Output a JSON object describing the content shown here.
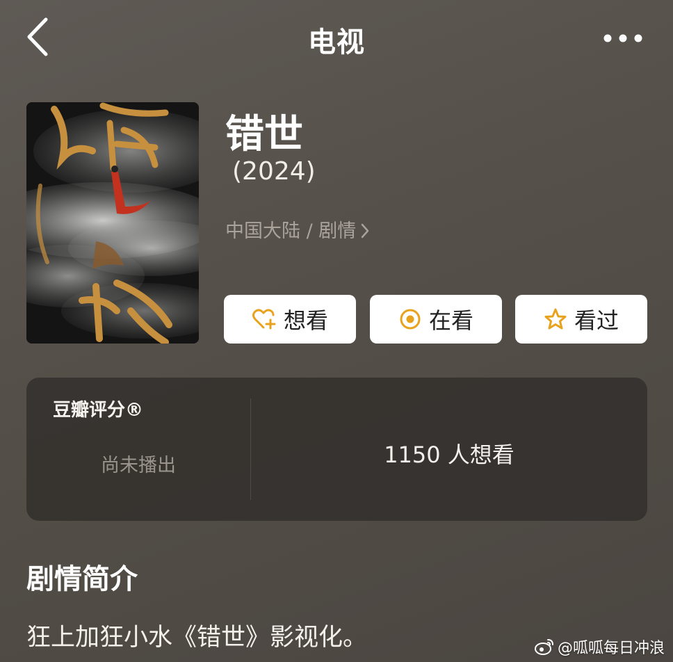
{
  "header": {
    "title": "电视",
    "back_icon": "chevron-left-icon",
    "more_icon": "more-dots-icon"
  },
  "movie": {
    "title": "错世",
    "year": "(2024)",
    "meta": "中国大陆 / 剧情",
    "poster_icon": "poster-image"
  },
  "actions": [
    {
      "label": "想看",
      "icon": "heart-plus-icon"
    },
    {
      "label": "在看",
      "icon": "target-icon"
    },
    {
      "label": "看过",
      "icon": "star-icon"
    }
  ],
  "rating": {
    "label": "豆瓣评分®",
    "status": "尚未播出",
    "want_count": "1150 人想看"
  },
  "synopsis": {
    "heading": "剧情简介",
    "text": "狂上加狂小水《错世》影视化。"
  },
  "watermark": {
    "text": "@呱呱每日冲浪",
    "icon": "weibo-icon"
  },
  "colors": {
    "accent": "#E8A21C",
    "background": "#57524C",
    "card": "#302D2A"
  }
}
